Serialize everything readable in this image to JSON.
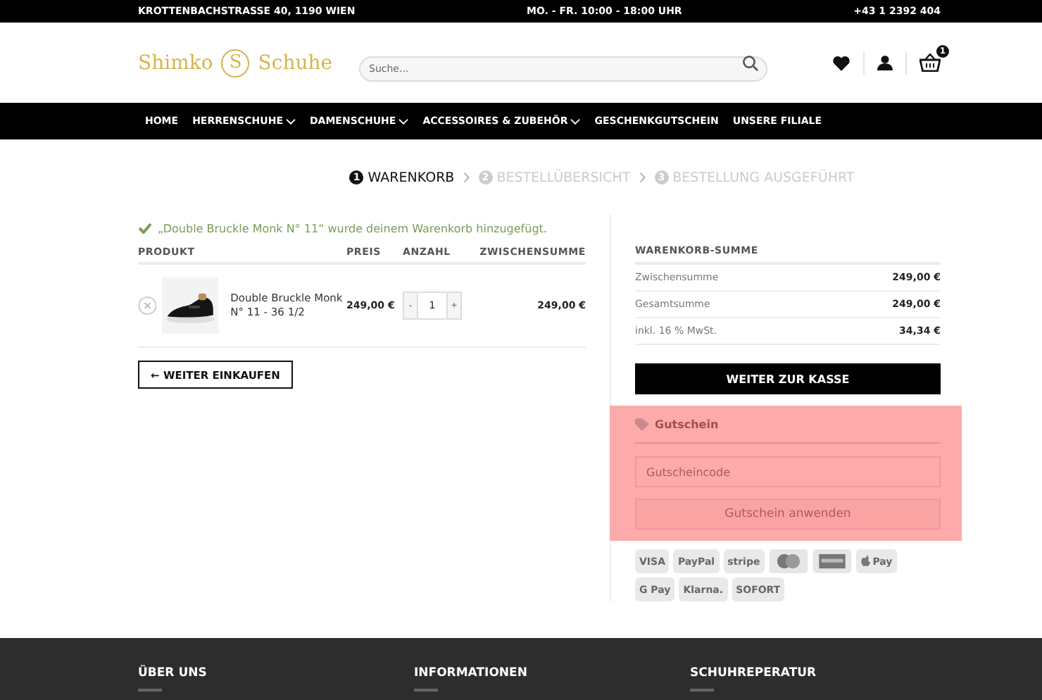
{
  "topbar": {
    "address": "KROTTENBACHSTRASSE 40, 1190 WIEN",
    "hours": "MO. - FR. 10:00 - 18:00 UHR",
    "phone": "+43 1 2392 404"
  },
  "logo": {
    "left": "Shimko",
    "mark": "S",
    "right": "Schuhe"
  },
  "search": {
    "placeholder": "Suche..."
  },
  "cart_count": "1",
  "nav": [
    {
      "label": "HOME",
      "dropdown": false
    },
    {
      "label": "HERRENSCHUHE",
      "dropdown": true
    },
    {
      "label": "DAMENSCHUHE",
      "dropdown": true
    },
    {
      "label": "ACCESSOIRES & ZUBEHÖR",
      "dropdown": true
    },
    {
      "label": "GESCHENKGUTSCHEIN",
      "dropdown": false
    },
    {
      "label": "UNSERE FILIALE",
      "dropdown": false
    }
  ],
  "steps": [
    {
      "number": "1",
      "label": "WARENKORB",
      "selected": true
    },
    {
      "number": "2",
      "label": "BESTELLÜBERSICHT",
      "selected": false
    },
    {
      "number": "3",
      "label": "BESTELLUNG AUSGEFÜHRT",
      "selected": false
    }
  ],
  "notice": "„Double Bruckle Monk N° 11“ wurde deinem Warenkorb hinzugefügt.",
  "cart": {
    "columns": [
      "PRODUKT",
      "PREIS",
      "ANZAHL",
      "ZWISCHENSUMME"
    ],
    "rows": [
      {
        "name": "Double Bruckle Monk N° 11 - 36 1/2",
        "price": "249,00 €",
        "minus": "-",
        "quantity": "1",
        "plus": "+",
        "subtotal": "249,00 €"
      }
    ]
  },
  "continue_button": "← WEITER EINKAUFEN",
  "totals": {
    "title": "WARENKORB-SUMME",
    "rows": [
      {
        "label": "Zwischensumme",
        "value": "249,00 €"
      },
      {
        "label": "Gesamtsumme",
        "value": "249,00 €"
      },
      {
        "label": "inkl. 16 % MwSt.",
        "value": "34,34 €"
      }
    ],
    "checkout": "WEITER ZUR KASSE"
  },
  "coupon": {
    "title": "Gutschein",
    "placeholder": "Gutscheincode",
    "button": "Gutschein anwenden"
  },
  "payments": [
    {
      "kind": "text",
      "label": "VISA"
    },
    {
      "kind": "text",
      "label": "PayPal"
    },
    {
      "kind": "text",
      "label": "stripe"
    },
    {
      "kind": "mastercard"
    },
    {
      "kind": "amex"
    },
    {
      "kind": "apple",
      "label": "Pay"
    },
    {
      "kind": "text",
      "label": "G Pay"
    },
    {
      "kind": "text",
      "label": "Klarna."
    },
    {
      "kind": "text",
      "label": "SOFORT"
    }
  ],
  "footer": [
    "ÜBER UNS",
    "INFORMATIONEN",
    "SCHUHREPERATUR"
  ]
}
